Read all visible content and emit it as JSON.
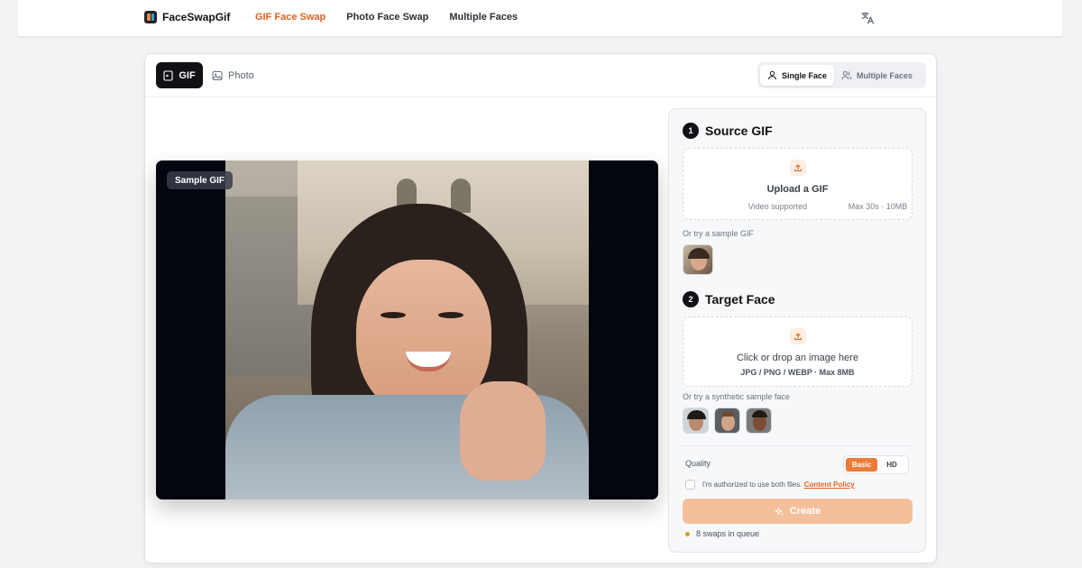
{
  "brand": {
    "name": "FaceSwapGif",
    "accent": "#e2621f"
  },
  "nav": [
    {
      "label": "GIF Face Swap",
      "active": true
    },
    {
      "label": "Photo Face Swap",
      "active": false
    },
    {
      "label": "Multiple Faces",
      "active": false
    }
  ],
  "header": {
    "language_icon": "translate-icon"
  },
  "mode_tabs": {
    "gif": "GIF",
    "photo": "Photo"
  },
  "face_mode": {
    "single": "Single Face",
    "multiple": "Multiple Faces"
  },
  "preview": {
    "badge": "Sample GIF"
  },
  "source": {
    "step": "1",
    "title": "Source GIF",
    "upload_title": "Upload a GIF",
    "note_left": "Video supported",
    "note_right": "Max 30s · 10MB",
    "sample_hint": "Or try a sample GIF"
  },
  "target": {
    "step": "2",
    "title": "Target Face",
    "upload_title": "Click or drop an image here",
    "formats": "JPG / PNG / WEBP · Max 8MB",
    "sample_hint": "Or try a synthetic sample face"
  },
  "quality": {
    "label": "Quality",
    "basic": "Basic",
    "hd": "HD",
    "selected": "Basic"
  },
  "consent": {
    "text": "I'm authorized to use both files.",
    "policy_link": "Content Policy",
    "checked": false
  },
  "create_button": "Create",
  "queue": {
    "text": "8 swaps in queue"
  }
}
